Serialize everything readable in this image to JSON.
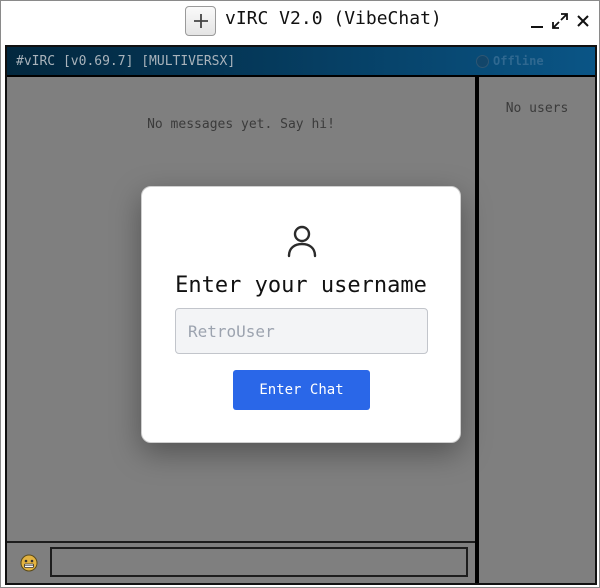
{
  "window": {
    "title": "vIRC V2.0 (VibeChat)",
    "controls": {
      "new": "plus-icon",
      "minimize": "minimize-icon",
      "maximize": "maximize-icon",
      "close": "close-icon"
    }
  },
  "header": {
    "channel_title": "#vIRC [v0.69.7] [MULTIVERSX]",
    "status_label": "Offline"
  },
  "messages": {
    "empty_text": "No messages yet. Say hi!"
  },
  "users": {
    "empty_text": "No users"
  },
  "input_bar": {
    "emoji_icon": "emoji-icon",
    "message_value": ""
  },
  "login_modal": {
    "icon": "user-icon",
    "title": "Enter your username",
    "username_placeholder": "RetroUser",
    "username_value": "",
    "submit_label": "Enter Chat"
  },
  "colors": {
    "accent": "#2a67e8",
    "header_dark": "#02273e",
    "header_light": "#0a5586",
    "panel_bg": "#7f7f7f"
  }
}
